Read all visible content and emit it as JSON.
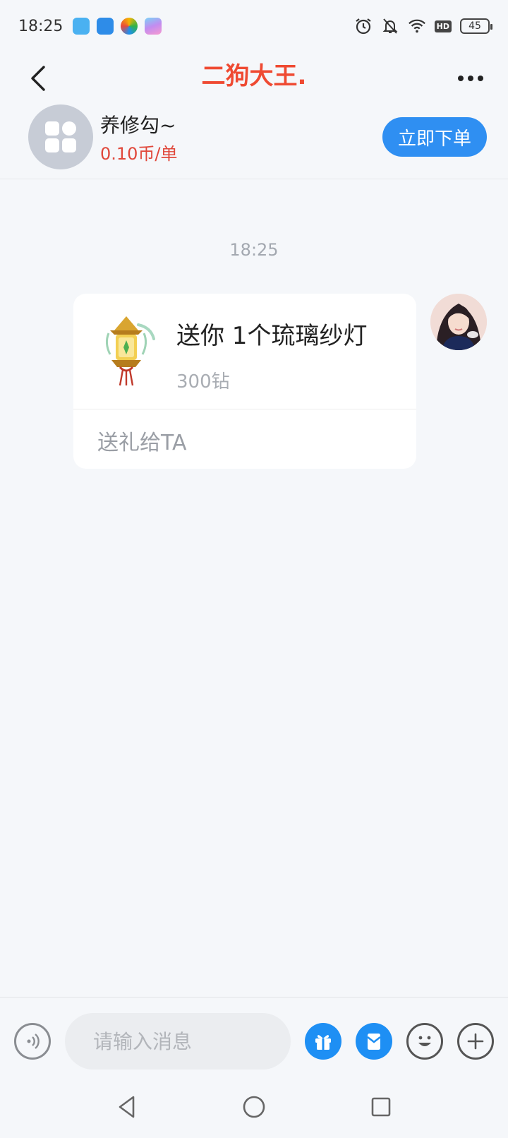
{
  "status_bar": {
    "time": "18:25",
    "battery": "45",
    "hd_label": "HD",
    "app_icons": [
      "app-blue-rabbit",
      "app-blue-face",
      "app-colorful-ring",
      "app-gradient-cup"
    ],
    "status_icons": [
      "alarm-icon",
      "bell-off-icon",
      "wifi-icon",
      "hd-icon",
      "battery-icon"
    ]
  },
  "nav": {
    "title": "二狗大王.",
    "title_color": "#ef4a32"
  },
  "service": {
    "name": "养修勾~",
    "price": "0.10币/单",
    "order_button": "立即下单",
    "accent": "#2f8ff2"
  },
  "chat": {
    "timestamp": "18:25",
    "gift_message": {
      "title": "送你 1个琉璃纱灯",
      "price": "300钻",
      "action": "送礼给TA"
    }
  },
  "input_bar": {
    "placeholder": "请输入消息"
  }
}
